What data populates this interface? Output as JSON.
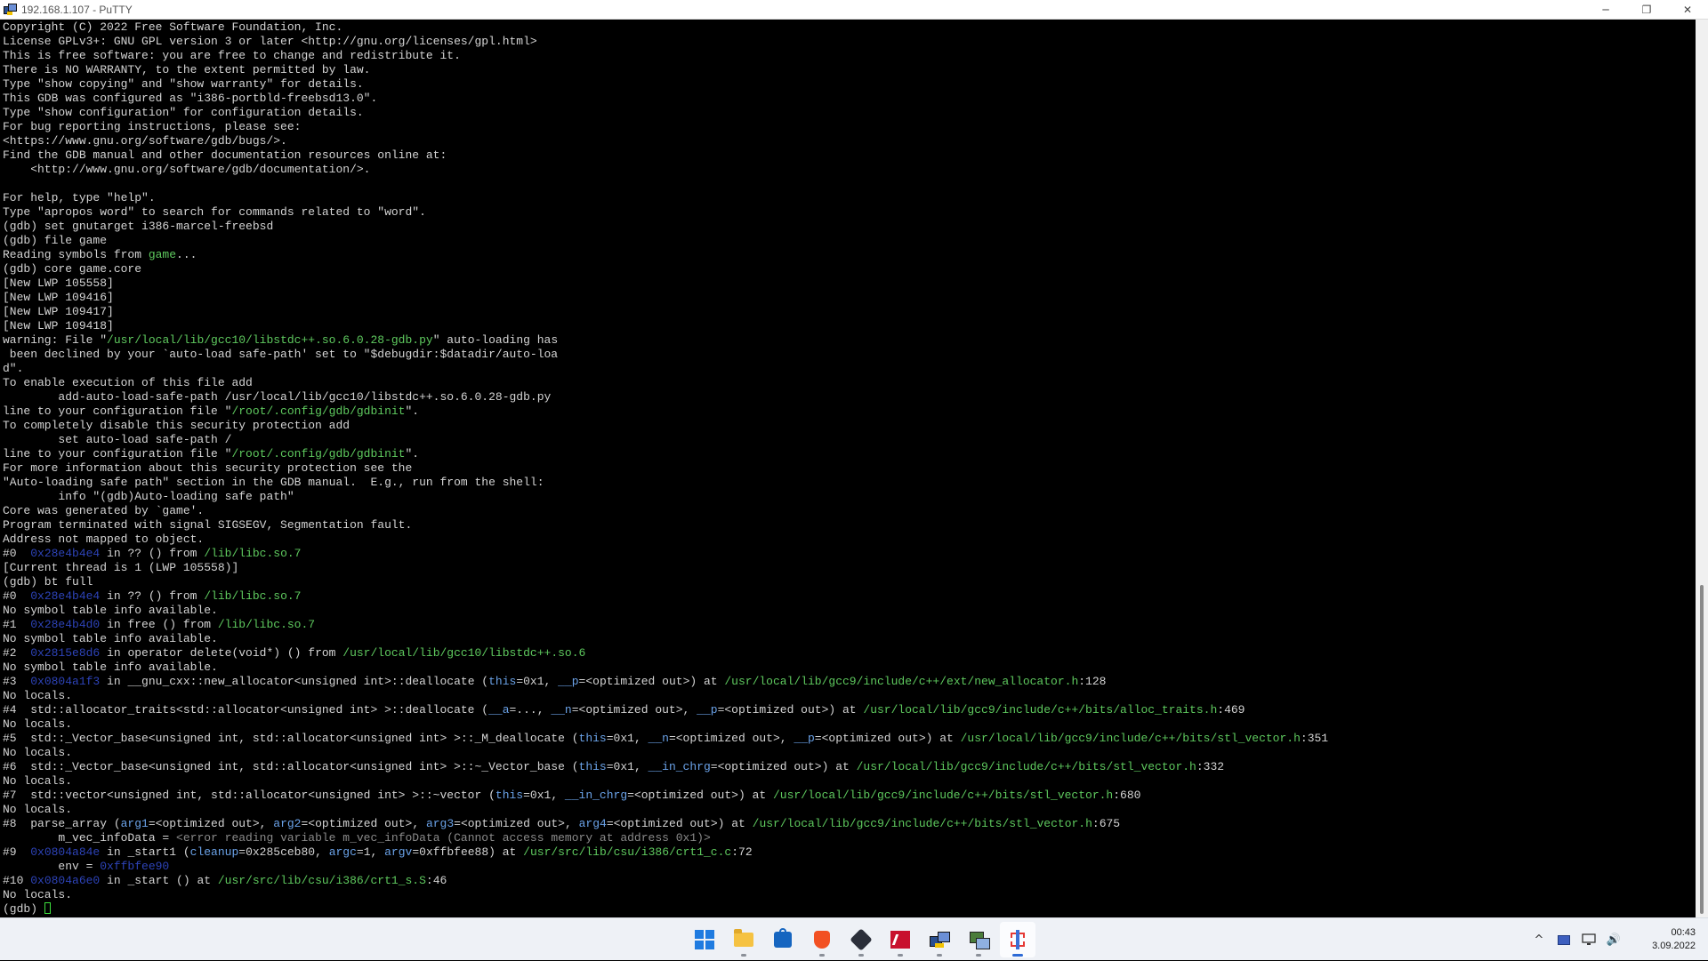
{
  "window": {
    "title": "192.168.1.107 - PuTTY",
    "controls": [
      "minimize",
      "maximize",
      "close"
    ],
    "minimize_glyph": "─",
    "maximize_glyph": "❐",
    "close_glyph": "✕"
  },
  "terminal": {
    "lines": [
      [
        {
          "t": "Copyright (C) 2022 Free Software Foundation, Inc."
        }
      ],
      [
        {
          "t": "License GPLv3+: GNU GPL version 3 or later <http://gnu.org/licenses/gpl.html>"
        }
      ],
      [
        {
          "t": "This is free software: you are free to change and redistribute it."
        }
      ],
      [
        {
          "t": "There is NO WARRANTY, to the extent permitted by law."
        }
      ],
      [
        {
          "t": "Type \"show copying\" and \"show warranty\" for details."
        }
      ],
      [
        {
          "t": "This GDB was configured as \"i386-portbld-freebsd13.0\"."
        }
      ],
      [
        {
          "t": "Type \"show configuration\" for configuration details."
        }
      ],
      [
        {
          "t": "For bug reporting instructions, please see:"
        }
      ],
      [
        {
          "t": "<https://www.gnu.org/software/gdb/bugs/>."
        }
      ],
      [
        {
          "t": "Find the GDB manual and other documentation resources online at:"
        }
      ],
      [
        {
          "t": "    <http://www.gnu.org/software/gdb/documentation/>."
        }
      ],
      [
        {
          "t": ""
        }
      ],
      [
        {
          "t": "For help, type \"help\"."
        }
      ],
      [
        {
          "t": "Type \"apropos word\" to search for commands related to \"word\"."
        }
      ],
      [
        {
          "t": "(gdb) set gnutarget i386-marcel-freebsd"
        }
      ],
      [
        {
          "t": "(gdb) file game"
        }
      ],
      [
        {
          "t": "Reading symbols from "
        },
        {
          "t": "game",
          "c": "green"
        },
        {
          "t": "..."
        }
      ],
      [
        {
          "t": "(gdb) core game.core"
        }
      ],
      [
        {
          "t": "[New LWP 105558]"
        }
      ],
      [
        {
          "t": "[New LWP 109416]"
        }
      ],
      [
        {
          "t": "[New LWP 109417]"
        }
      ],
      [
        {
          "t": "[New LWP 109418]"
        }
      ],
      [
        {
          "t": "warning: File \""
        },
        {
          "t": "/usr/local/lib/gcc10/libstdc++.so.6.0.28-gdb.py",
          "c": "green"
        },
        {
          "t": "\" auto-loading has"
        }
      ],
      [
        {
          "t": " been declined by your `auto-load safe-path' set to \"$debugdir:$datadir/auto-loa"
        }
      ],
      [
        {
          "t": "d\"."
        }
      ],
      [
        {
          "t": "To enable execution of this file add"
        }
      ],
      [
        {
          "t": "        add-auto-load-safe-path /usr/local/lib/gcc10/libstdc++.so.6.0.28-gdb.py"
        }
      ],
      [
        {
          "t": "line to your configuration file \""
        },
        {
          "t": "/root/.config/gdb/gdbinit",
          "c": "green"
        },
        {
          "t": "\"."
        }
      ],
      [
        {
          "t": "To completely disable this security protection add"
        }
      ],
      [
        {
          "t": "        set auto-load safe-path /"
        }
      ],
      [
        {
          "t": "line to your configuration file \""
        },
        {
          "t": "/root/.config/gdb/gdbinit",
          "c": "green"
        },
        {
          "t": "\"."
        }
      ],
      [
        {
          "t": "For more information about this security protection see the"
        }
      ],
      [
        {
          "t": "\"Auto-loading safe path\" section in the GDB manual.  E.g., run from the shell:"
        }
      ],
      [
        {
          "t": "        info \"(gdb)Auto-loading safe path\""
        }
      ],
      [
        {
          "t": "Core was generated by `game'."
        }
      ],
      [
        {
          "t": "Program terminated with signal SIGSEGV, Segmentation fault."
        }
      ],
      [
        {
          "t": "Address not mapped to object."
        }
      ],
      [
        {
          "t": "#0  "
        },
        {
          "t": "0x28e4b4e4",
          "c": "blue"
        },
        {
          "t": " in ?? () from "
        },
        {
          "t": "/lib/libc.so.7",
          "c": "green"
        }
      ],
      [
        {
          "t": "[Current thread is 1 (LWP 105558)]"
        }
      ],
      [
        {
          "t": "(gdb) bt full"
        }
      ],
      [
        {
          "t": "#0  "
        },
        {
          "t": "0x28e4b4e4",
          "c": "blue"
        },
        {
          "t": " in ?? () from "
        },
        {
          "t": "/lib/libc.so.7",
          "c": "green"
        }
      ],
      [
        {
          "t": "No symbol table info available."
        }
      ],
      [
        {
          "t": "#1  "
        },
        {
          "t": "0x28e4b4d0",
          "c": "blue"
        },
        {
          "t": " in free () from "
        },
        {
          "t": "/lib/libc.so.7",
          "c": "green"
        }
      ],
      [
        {
          "t": "No symbol table info available."
        }
      ],
      [
        {
          "t": "#2  "
        },
        {
          "t": "0x2815e8d6",
          "c": "blue"
        },
        {
          "t": " in operator delete(void*) () from "
        },
        {
          "t": "/usr/local/lib/gcc10/libstdc++.so.6",
          "c": "green"
        }
      ],
      [
        {
          "t": "No symbol table info available."
        }
      ],
      [
        {
          "t": "#3  "
        },
        {
          "t": "0x0804a1f3",
          "c": "blue"
        },
        {
          "t": " in __gnu_cxx::new_allocator<unsigned int>::deallocate ("
        },
        {
          "t": "this",
          "c": "arg"
        },
        {
          "t": "=0x1, "
        },
        {
          "t": "__p",
          "c": "arg"
        },
        {
          "t": "=<optimized out>) at "
        },
        {
          "t": "/usr/local/lib/gcc9/include/c++/ext/new_allocator.h",
          "c": "green"
        },
        {
          "t": ":128"
        }
      ],
      [
        {
          "t": "No locals."
        }
      ],
      [
        {
          "t": "#4  std::allocator_traits<std::allocator<unsigned int> >::deallocate ("
        },
        {
          "t": "__a",
          "c": "arg"
        },
        {
          "t": "=..., "
        },
        {
          "t": "__n",
          "c": "arg"
        },
        {
          "t": "=<optimized out>, "
        },
        {
          "t": "__p",
          "c": "arg"
        },
        {
          "t": "=<optimized out>) at "
        },
        {
          "t": "/usr/local/lib/gcc9/include/c++/bits/alloc_traits.h",
          "c": "green"
        },
        {
          "t": ":469"
        }
      ],
      [
        {
          "t": "No locals."
        }
      ],
      [
        {
          "t": "#5  std::_Vector_base<unsigned int, std::allocator<unsigned int> >::_M_deallocate ("
        },
        {
          "t": "this",
          "c": "arg"
        },
        {
          "t": "=0x1, "
        },
        {
          "t": "__n",
          "c": "arg"
        },
        {
          "t": "=<optimized out>, "
        },
        {
          "t": "__p",
          "c": "arg"
        },
        {
          "t": "=<optimized out>) at "
        },
        {
          "t": "/usr/local/lib/gcc9/include/c++/bits/stl_vector.h",
          "c": "green"
        },
        {
          "t": ":351"
        }
      ],
      [
        {
          "t": "No locals."
        }
      ],
      [
        {
          "t": "#6  std::_Vector_base<unsigned int, std::allocator<unsigned int> >::~_Vector_base ("
        },
        {
          "t": "this",
          "c": "arg"
        },
        {
          "t": "=0x1, "
        },
        {
          "t": "__in_chrg",
          "c": "arg"
        },
        {
          "t": "=<optimized out>) at "
        },
        {
          "t": "/usr/local/lib/gcc9/include/c++/bits/stl_vector.h",
          "c": "green"
        },
        {
          "t": ":332"
        }
      ],
      [
        {
          "t": "No locals."
        }
      ],
      [
        {
          "t": "#7  std::vector<unsigned int, std::allocator<unsigned int> >::~vector ("
        },
        {
          "t": "this",
          "c": "arg"
        },
        {
          "t": "=0x1, "
        },
        {
          "t": "__in_chrg",
          "c": "arg"
        },
        {
          "t": "=<optimized out>) at "
        },
        {
          "t": "/usr/local/lib/gcc9/include/c++/bits/stl_vector.h",
          "c": "green"
        },
        {
          "t": ":680"
        }
      ],
      [
        {
          "t": "No locals."
        }
      ],
      [
        {
          "t": "#8  parse_array ("
        },
        {
          "t": "arg1",
          "c": "arg"
        },
        {
          "t": "=<optimized out>, "
        },
        {
          "t": "arg2",
          "c": "arg"
        },
        {
          "t": "=<optimized out>, "
        },
        {
          "t": "arg3",
          "c": "arg"
        },
        {
          "t": "=<optimized out>, "
        },
        {
          "t": "arg4",
          "c": "arg"
        },
        {
          "t": "=<optimized out>) at "
        },
        {
          "t": "/usr/local/lib/gcc9/include/c++/bits/stl_vector.h",
          "c": "green"
        },
        {
          "t": ":675"
        }
      ],
      [
        {
          "t": "        m_vec_infoData = "
        },
        {
          "t": "<error reading variable m_vec_infoData (Cannot access memory at address 0x1)>",
          "c": "gray"
        }
      ],
      [
        {
          "t": "#9  "
        },
        {
          "t": "0x0804a84e",
          "c": "blue"
        },
        {
          "t": " in _start1 ("
        },
        {
          "t": "cleanup",
          "c": "arg"
        },
        {
          "t": "=0x285ceb80, "
        },
        {
          "t": "argc",
          "c": "arg"
        },
        {
          "t": "=1, "
        },
        {
          "t": "argv",
          "c": "arg"
        },
        {
          "t": "=0xffbfee88) at "
        },
        {
          "t": "/usr/src/lib/csu/i386/crt1_c.c",
          "c": "green"
        },
        {
          "t": ":72"
        }
      ],
      [
        {
          "t": "        env = "
        },
        {
          "t": "0xffbfee90",
          "c": "blue"
        }
      ],
      [
        {
          "t": "#10 "
        },
        {
          "t": "0x0804a6e0",
          "c": "blue"
        },
        {
          "t": " in _start () at "
        },
        {
          "t": "/usr/src/lib/csu/i386/crt1_s.S",
          "c": "green"
        },
        {
          "t": ":46"
        }
      ],
      [
        {
          "t": "No locals."
        }
      ],
      [
        {
          "t": "(gdb) "
        }
      ]
    ]
  },
  "taskbar": {
    "apps": [
      {
        "name": "start-button",
        "icon": "windows-logo-icon"
      },
      {
        "name": "taskbar-file-explorer",
        "icon": "folder-icon"
      },
      {
        "name": "taskbar-microsoft-store",
        "icon": "store-bag-icon"
      },
      {
        "name": "taskbar-brave-browser",
        "icon": "brave-lion-icon"
      },
      {
        "name": "taskbar-virtualbox",
        "icon": "cube-icon"
      },
      {
        "name": "taskbar-red-app",
        "icon": "red-square-icon"
      },
      {
        "name": "taskbar-putty",
        "icon": "putty-icon"
      },
      {
        "name": "taskbar-network-app",
        "icon": "network-computers-icon"
      },
      {
        "name": "taskbar-snipping-tool",
        "icon": "snipping-tool-icon"
      }
    ],
    "tray": {
      "chevron": "^",
      "speaker": "🔊",
      "time": "00:43",
      "date": "3.09.2022"
    }
  }
}
